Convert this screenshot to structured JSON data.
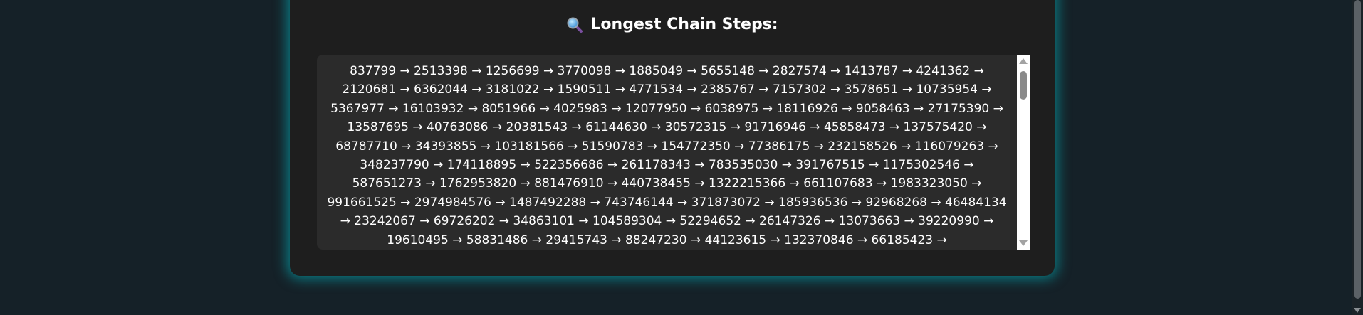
{
  "heading": {
    "icon": "magnifying-glass-icon",
    "title": "Longest Chain Steps:"
  },
  "chain": {
    "text": "837799 → 2513398 → 1256699 → 3770098 → 1885049 → 5655148 → 2827574 → 1413787 → 4241362 → 2120681 → 6362044 → 3181022 → 1590511 → 4771534 → 2385767 → 7157302 → 3578651 → 10735954 → 5367977 → 16103932 → 8051966 → 4025983 → 12077950 → 6038975 → 18116926 → 9058463 → 27175390 → 13587695 → 40763086 → 20381543 → 61144630 → 30572315 → 91716946 → 45858473 → 137575420 → 68787710 → 34393855 → 103181566 → 51590783 → 154772350 → 77386175 → 232158526 → 116079263 → 348237790 → 174118895 → 522356686 → 261178343 → 783535030 → 391767515 → 1175302546 → 587651273 → 1762953820 → 881476910 → 440738455 → 1322215366 → 661107683 → 1983323050 → 991661525 → 2974984576 → 1487492288 → 743746144 → 371873072 → 185936536 → 92968268 → 46484134 → 23242067 → 69726202 → 34863101 → 104589304 → 52294652 → 26147326 → 13073663 → 39220990 → 19610495 → 58831486 → 29415743 → 88247230 → 44123615 → 132370846 → 66185423 →"
  },
  "colors": {
    "background": "#152128",
    "card": "#1e1e1e",
    "chain_box": "#2b2b2b",
    "glow": "#00c8d2",
    "text": "#ffffff"
  }
}
